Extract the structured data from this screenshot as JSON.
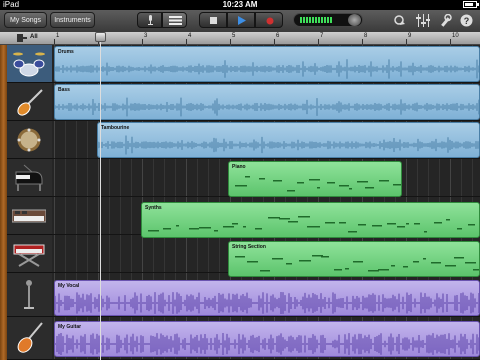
{
  "status_bar": {
    "device": "iPad",
    "time": "10:23 AM"
  },
  "toolbar": {
    "my_songs_label": "My Songs",
    "instruments_label": "Instruments",
    "level_meter": 0.75
  },
  "ruler": {
    "all_label": "All",
    "bars": [
      "1",
      "2",
      "3",
      "4",
      "5",
      "6",
      "7",
      "8",
      "9",
      "10"
    ]
  },
  "tracks": [
    {
      "instrument_icon": "drum-kit-icon",
      "regions": [
        {
          "name": "Drums",
          "color": "blue"
        }
      ]
    },
    {
      "instrument_icon": "bass-guitar-icon",
      "regions": [
        {
          "name": "Bass",
          "color": "blue"
        }
      ]
    },
    {
      "instrument_icon": "tambourine-icon",
      "regions": [
        {
          "name": "Tambourine",
          "color": "blue"
        }
      ]
    },
    {
      "instrument_icon": "grand-piano-icon",
      "regions": [
        {
          "name": "Piano",
          "color": "green"
        }
      ]
    },
    {
      "instrument_icon": "synth-keyboard-icon",
      "regions": [
        {
          "name": "Synths",
          "color": "green"
        }
      ]
    },
    {
      "instrument_icon": "keyboard-stand-icon",
      "regions": [
        {
          "name": "String Section",
          "color": "green"
        }
      ]
    },
    {
      "instrument_icon": "microphone-icon",
      "regions": [
        {
          "name": "My Vocal",
          "color": "purple"
        }
      ]
    },
    {
      "instrument_icon": "electric-guitar-icon",
      "regions": [
        {
          "name": "My Guitar",
          "color": "purple"
        }
      ]
    }
  ],
  "colors": {
    "audio_blue": "#9cc3e0",
    "midi_green": "#7ed68a",
    "recorded_purple": "#b1a1e3",
    "record_red": "#d03030",
    "play_blue": "#3d8fe6"
  }
}
